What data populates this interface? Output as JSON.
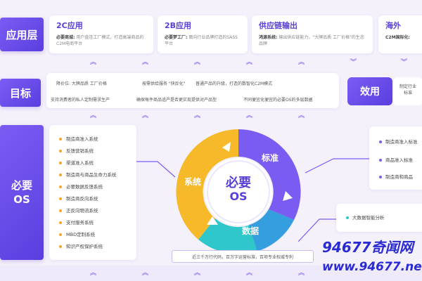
{
  "rows": {
    "application": "应用层",
    "goal": "目标",
    "required_os": "必要\nOS"
  },
  "apps": [
    {
      "title": "2C应用",
      "key": "必要商城:",
      "desc": "用户直连工厂模式，打造高端商品的C2M电商平台"
    },
    {
      "title": "2B应用",
      "key": "必要梦工厂:",
      "desc": "面向行业品牌打造的SASS平台"
    },
    {
      "title": "供应链输出",
      "key": "鸿源系统:",
      "desc": "输出供应链能力，\"大牌品质 工厂价格\"的生态品牌"
    },
    {
      "title": "海外",
      "key": "C2M国际化:",
      "desc": ""
    }
  ],
  "goals": [
    "降价位: 大牌品质 工厂价格",
    "按需供给服务 \"快反化\"",
    "普通产品的升级，打造的数智化C2M模式",
    "支持消费者的私人定制需求生产",
    "确保每件商品适产是否更实现提供对产品型",
    "不同便宜化便宜的必要OS的多层数据"
  ],
  "effect": {
    "label": "效用",
    "text": "制定行业\n标准"
  },
  "systems": [
    "制造商准入系统",
    "反馈营销系统",
    "渠道准入系统",
    "制造商与商品生命力系统",
    "必要数据反馈系统",
    "制造商反向系统",
    "正反向物流系统",
    "支付服务系统",
    "MBD定制系统",
    "知识产权保护系统"
  ],
  "circle": {
    "center_line1": "必要",
    "center_line2": "OS",
    "seg_system": "系统",
    "seg_standard": "标准",
    "seg_data": "数据"
  },
  "standards": [
    "制造商准入标准",
    "商品准入标准",
    "制造商和商品"
  ],
  "data_items": [
    "大数据智能分析"
  ],
  "footer": "近三千万行代码，百万字运营标准，百项专业权威专利",
  "watermark": {
    "line1": "94677奇闻网",
    "line2": "www.94677.net"
  },
  "colors": {
    "purple": "#6b4ff0",
    "yellow": "#f5b92a",
    "cyan": "#2fc7c9",
    "blue": "#3b7cf0"
  }
}
